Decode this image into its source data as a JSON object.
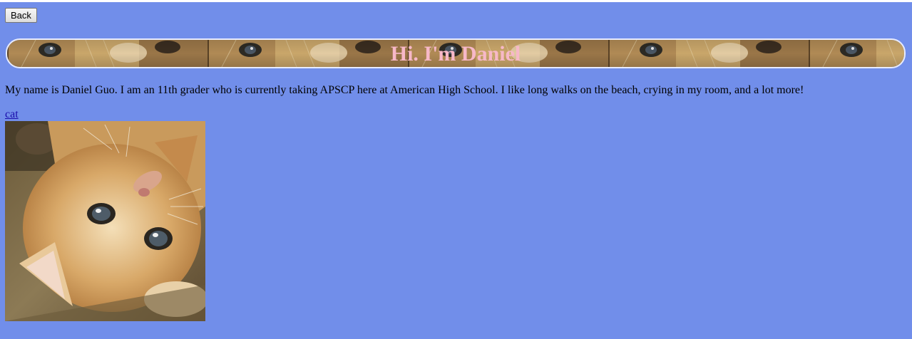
{
  "nav": {
    "back_label": "Back"
  },
  "header": {
    "title": "Hi. I'm Daniel"
  },
  "main": {
    "bio": "My name is Daniel Guo. I am an 11th grader who is currently taking APSCP here at American High School. I like long walks on the beach, crying in my room, and a lot more!",
    "link_label": "cat"
  },
  "colors": {
    "background": "#718eea",
    "title": "#f7b8c8",
    "link": "#1a0dab"
  },
  "images": {
    "banner": "repeated kitten face pattern",
    "photo": "kitten lying on its back"
  }
}
